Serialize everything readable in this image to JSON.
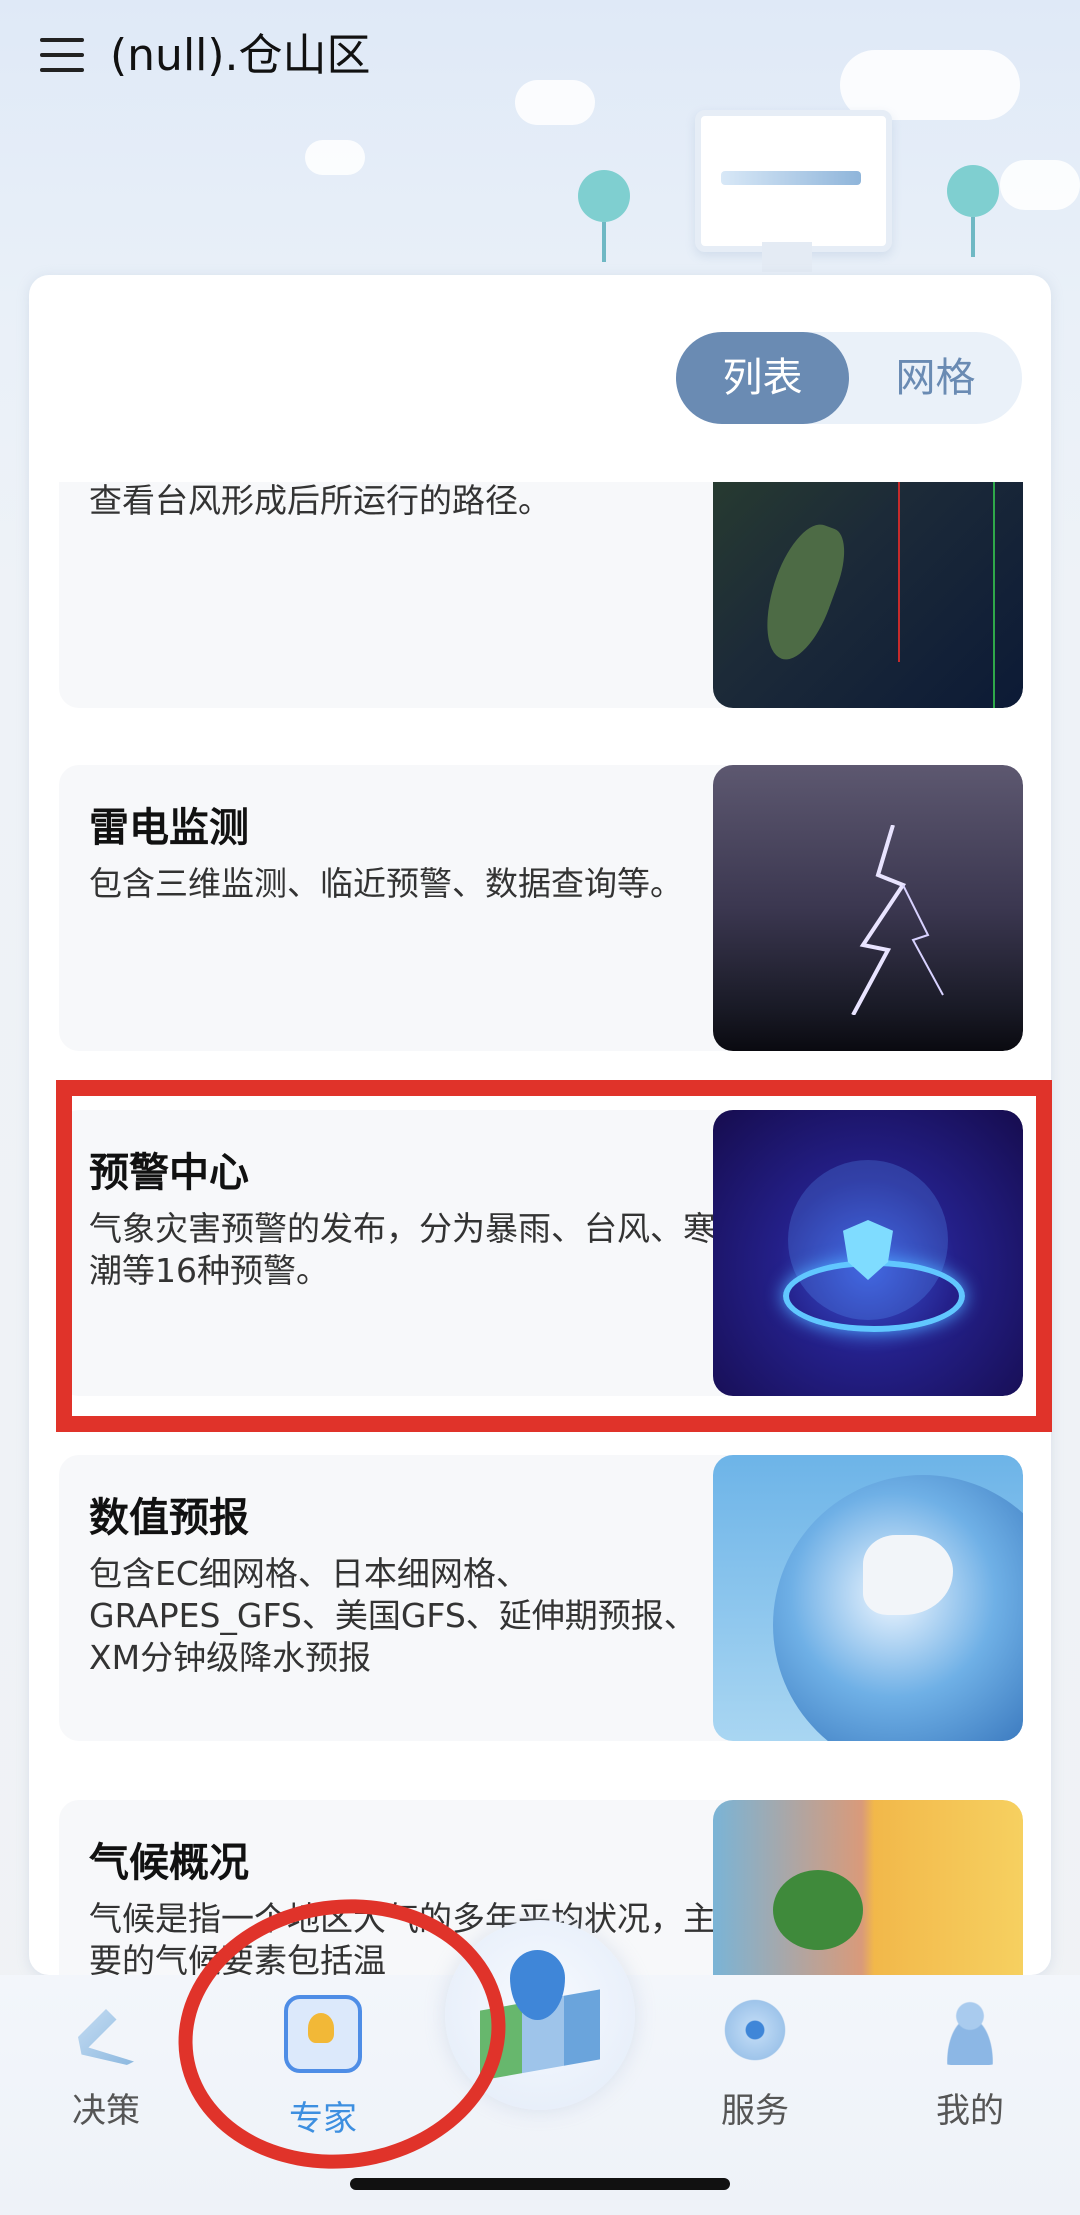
{
  "header": {
    "title": "(null).仓山区"
  },
  "view_toggle": {
    "list_label": "列表",
    "grid_label": "网格",
    "selected": "列表"
  },
  "items": [
    {
      "title": "",
      "desc": "查看台风形成后所运行的路径。",
      "thumb": "typhoon-track-map"
    },
    {
      "title": "雷电监测",
      "desc": "包含三维监测、临近预警、数据查询等。",
      "thumb": "lightning-photo"
    },
    {
      "title": "预警中心",
      "desc": "气象灾害预警的发布，分为暴雨、台风、寒潮等16种预警。",
      "thumb": "warning-shield-illustration"
    },
    {
      "title": "数值预报",
      "desc": "包含EC细网格、日本细网格、GRAPES_GFS、美国GFS、延伸期预报、XM分钟级降水预报",
      "thumb": "globe-forecast-maps"
    },
    {
      "title": "气候概况",
      "desc": "气候是指一个地区大气的多年平均状况，主要的气候要素包括温",
      "thumb": "climate-tree-photo"
    }
  ],
  "bottom_nav": {
    "tabs": [
      {
        "label": "决策",
        "icon": "gavel-icon"
      },
      {
        "label": "专家",
        "icon": "expert-icon",
        "active": true
      },
      {
        "label": "",
        "icon": "map-pin-icon"
      },
      {
        "label": "服务",
        "icon": "service-icon"
      },
      {
        "label": "我的",
        "icon": "user-icon"
      }
    ]
  },
  "colors": {
    "accent": "#3d8fe0",
    "toggle_selected": "#6a8bb3",
    "annotation_red": "#e0332a"
  }
}
